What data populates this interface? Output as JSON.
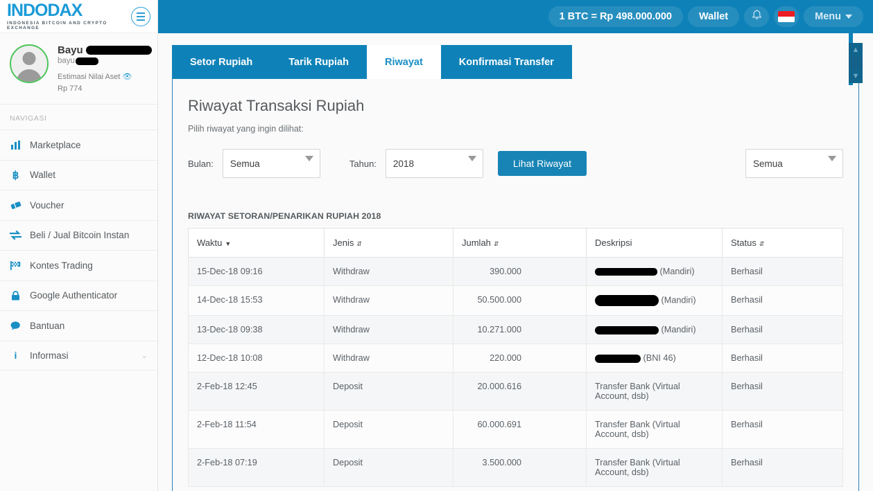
{
  "brand": {
    "logo": "INDODAX",
    "tagline": "INDONESIA BITCOIN AND CRYPTO EXCHANGE",
    "accent": "#1a9ad7",
    "header_blue": "#0e82b8"
  },
  "header": {
    "btc_rate": "1 BTC = Rp 498.000.000",
    "wallet": "Wallet",
    "bell_icon": "bell-icon",
    "flag_icon": "indonesia-flag-icon",
    "menu": "Menu"
  },
  "profile": {
    "name": "Bayu",
    "name_redacted": true,
    "email": "bayu",
    "email_redacted": true,
    "asset_label": "Estimasi Nilai Aset",
    "asset_value": "Rp 774",
    "eye_icon": "eye-icon"
  },
  "sidebar": {
    "section_label": "NAVIGASI",
    "items": [
      {
        "label": "Marketplace",
        "icon": "bar-chart-icon",
        "glyph": "ᵛ"
      },
      {
        "label": "Wallet",
        "icon": "bitcoin-icon",
        "glyph": "฿"
      },
      {
        "label": "Voucher",
        "icon": "ticket-icon",
        "glyph": "❖"
      },
      {
        "label": "Beli / Jual Bitcoin Instan",
        "icon": "exchange-arrows-icon",
        "glyph": "⇄"
      },
      {
        "label": "Kontes Trading",
        "icon": "checkered-flag-icon",
        "glyph": "⚑"
      },
      {
        "label": "Google Authenticator",
        "icon": "lock-icon",
        "glyph": "ὑ2"
      },
      {
        "label": "Bantuan",
        "icon": "chat-bubble-icon",
        "glyph": "●"
      },
      {
        "label": "Informasi",
        "icon": "info-icon",
        "glyph": "i",
        "chevron": "⌄"
      }
    ]
  },
  "tabs": [
    {
      "label": "Setor Rupiah",
      "active": false
    },
    {
      "label": "Tarik Rupiah",
      "active": false
    },
    {
      "label": "Riwayat",
      "active": true
    },
    {
      "label": "Konfirmasi Transfer",
      "active": false
    }
  ],
  "main": {
    "page_title": "Riwayat Transaksi Rupiah",
    "subtitle": "Pilih riwayat yang ingin dilihat:",
    "filters": {
      "month_label": "Bulan:",
      "month_value": "Semua",
      "year_label": "Tahun:",
      "year_value": "2018",
      "submit_label": "Lihat Riwayat",
      "type_value": "Semua"
    },
    "table_caption": "RIWAYAT SETORAN/PENARIKAN RUPIAH 2018",
    "columns": [
      {
        "label": "Waktu",
        "sort": "desc"
      },
      {
        "label": "Jenis",
        "sort": "both"
      },
      {
        "label": "Jumlah",
        "sort": "both"
      },
      {
        "label": "Deskripsi",
        "sort": "none"
      },
      {
        "label": "Status",
        "sort": "both"
      }
    ],
    "rows": [
      {
        "waktu": "15-Dec-18 09:16",
        "jenis": "Withdraw",
        "jumlah": "390.000",
        "deskripsi_redacted": "rr1",
        "deskripsi": "(Mandiri)",
        "status": "Berhasil"
      },
      {
        "waktu": "14-Dec-18 15:53",
        "jenis": "Withdraw",
        "jumlah": "50.500.000",
        "deskripsi_redacted": "rr2",
        "deskripsi": "(Mandiri)",
        "status": "Berhasil"
      },
      {
        "waktu": "13-Dec-18 09:38",
        "jenis": "Withdraw",
        "jumlah": "10.271.000",
        "deskripsi_redacted": "rr3",
        "deskripsi": "(Mandiri)",
        "status": "Berhasil"
      },
      {
        "waktu": "12-Dec-18 10:08",
        "jenis": "Withdraw",
        "jumlah": "220.000",
        "deskripsi_redacted": "rr4",
        "deskripsi": "(BNI 46)",
        "status": "Berhasil"
      },
      {
        "waktu": "2-Feb-18 12:45",
        "jenis": "Deposit",
        "jumlah": "20.000.616",
        "deskripsi_redacted": null,
        "deskripsi": "Transfer Bank (Virtual Account, dsb)",
        "status": "Berhasil"
      },
      {
        "waktu": "2-Feb-18 11:54",
        "jenis": "Deposit",
        "jumlah": "60.000.691",
        "deskripsi_redacted": null,
        "deskripsi": "Transfer Bank (Virtual Account, dsb)",
        "status": "Berhasil"
      },
      {
        "waktu": "2-Feb-18 07:19",
        "jenis": "Deposit",
        "jumlah": "3.500.000",
        "deskripsi_redacted": null,
        "deskripsi": "Transfer Bank (Virtual Account, dsb)",
        "status": "Berhasil"
      }
    ]
  },
  "scroll": {
    "up_icon": "chevron-up-icon",
    "down_icon": "chevron-down-icon"
  }
}
